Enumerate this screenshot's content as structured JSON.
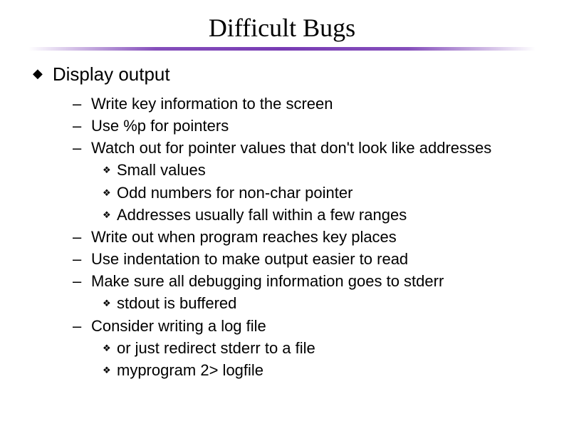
{
  "title": "Difficult Bugs",
  "main_bullet": "Display output",
  "items": [
    {
      "text": "Write key information to the screen",
      "sub": []
    },
    {
      "text": "Use %p for pointers",
      "sub": []
    },
    {
      "text": "Watch out for pointer values that don't look like addresses",
      "sub": [
        "Small values",
        "Odd numbers for non-char pointer",
        "Addresses usually fall within a few ranges"
      ]
    },
    {
      "text": "Write out when program reaches key places",
      "sub": []
    },
    {
      "text": "Use indentation to make output easier to read",
      "sub": []
    },
    {
      "text": "Make sure all debugging information goes to stderr",
      "sub": [
        "stdout is buffered"
      ]
    },
    {
      "text": "Consider writing a log file",
      "sub": [
        "or just redirect stderr to a file",
        "myprogram 2> logfile"
      ]
    }
  ]
}
